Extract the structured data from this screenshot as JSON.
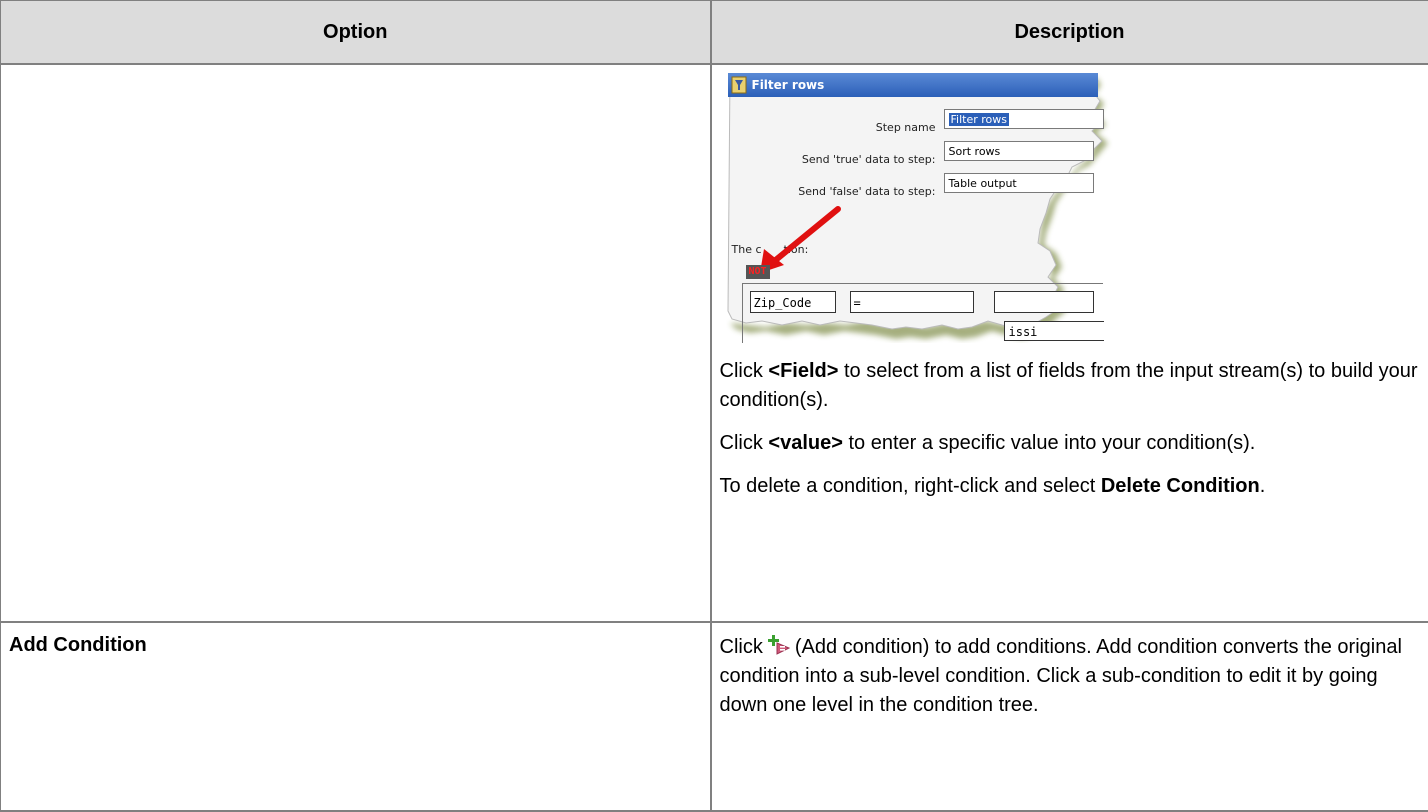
{
  "table": {
    "headers": {
      "option": "Option",
      "description": "Description"
    },
    "rows": [
      {
        "option": "",
        "screenshot": {
          "window_title": "Filter rows",
          "step_name_label": "Step name",
          "step_name_value": "Filter rows",
          "true_label": "Send 'true' data to step:",
          "true_value": "Sort rows",
          "false_label": "Send 'false' data to step:",
          "false_value": "Table output",
          "condition_label_visible": "The c",
          "condition_label_tail": "tion:",
          "not_badge": "NOT",
          "field": "Zip_Code",
          "operator": "=",
          "partial_text": "issi"
        },
        "p1": {
          "a": "Click ",
          "b": "<Field>",
          "c": " to select from a list of fields from the input stream(s) to build your condition(s)."
        },
        "p2": {
          "a": "Click ",
          "b": "<value>",
          "c": " to enter a specific value into your condition(s)."
        },
        "p3": {
          "a": "To delete a condition, right-click and select ",
          "b": "Delete Condition",
          "c": "."
        }
      },
      {
        "option": "Add Condition",
        "icon": "add-condition-icon",
        "text_before_icon": "Click",
        "text_after_icon": "(Add condition) to add conditions. Add condition converts the original condition into a sub-level condition. Click a sub-condition to edit it by going down one level in the condition tree."
      }
    ]
  },
  "colors": {
    "header_bg": "#dcdcdc",
    "border": "#808080",
    "titlebar": "#2b5fb8",
    "not_text": "#ff2020",
    "arrow": "#e01010"
  }
}
